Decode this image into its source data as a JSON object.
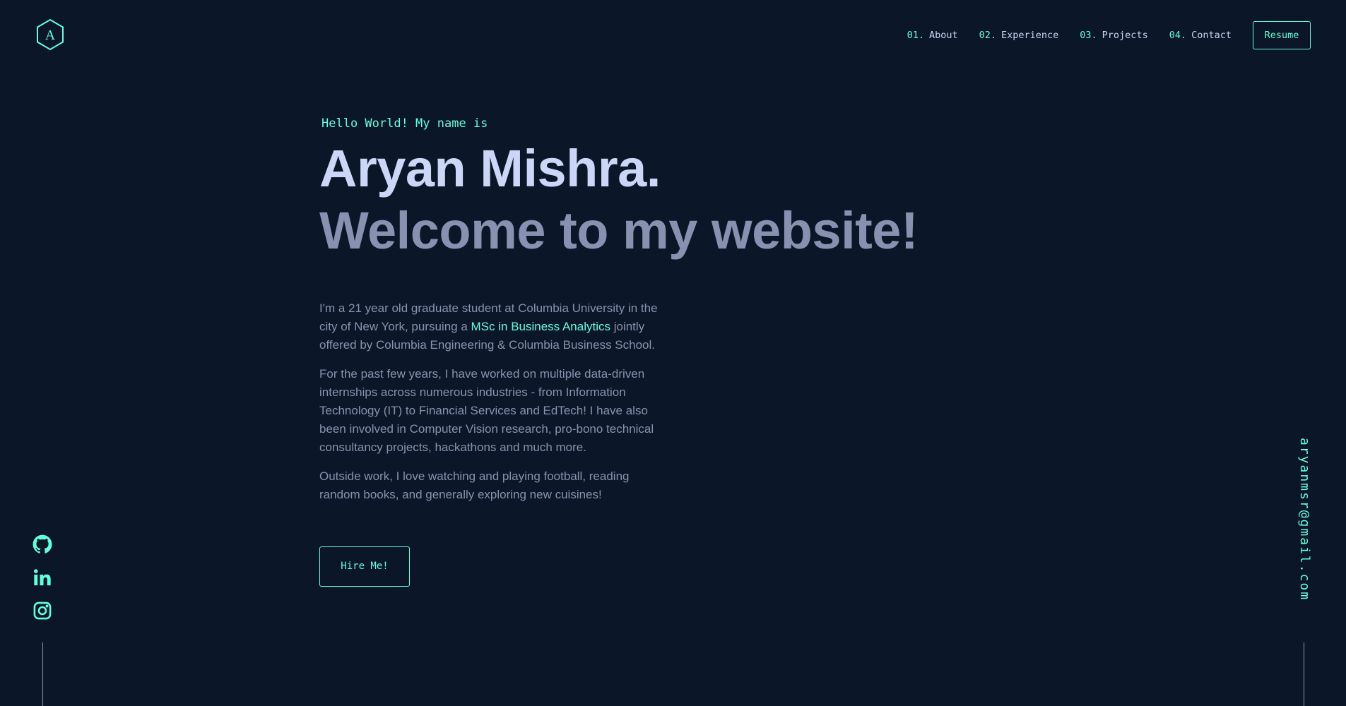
{
  "logo": {
    "letter": "A"
  },
  "nav": {
    "items": [
      {
        "num": "01.",
        "label": "About"
      },
      {
        "num": "02.",
        "label": "Experience"
      },
      {
        "num": "03.",
        "label": "Projects"
      },
      {
        "num": "04.",
        "label": "Contact"
      }
    ],
    "resume_label": "Resume"
  },
  "hero": {
    "greeting": "Hello World! My name is",
    "name": "Aryan Mishra.",
    "tagline": "Welcome to my website!",
    "bio1_before": "I'm a 21 year old graduate student at Columbia University in the city of New York, pursuing a ",
    "bio1_link": "MSc in Business Analytics",
    "bio1_after": " jointly offered by Columbia Engineering & Columbia Business School.",
    "bio2": "For the past few years, I have worked on multiple data-driven internships across numerous industries - from Information Technology (IT) to Financial Services and EdTech! I have also been involved in Computer Vision research, pro-bono technical consultancy projects, hackathons and much more.",
    "bio3": "Outside work, I love watching and playing football, reading random books, and generally exploring new cuisines!",
    "hire_label": "Hire Me!"
  },
  "socials": {
    "icons": [
      "github-icon",
      "linkedin-icon",
      "instagram-icon"
    ]
  },
  "email": "aryanmsr@gmail.com",
  "colors": {
    "background": "#0b1628",
    "accent": "#64ffda",
    "heading": "#ccd6f6",
    "body": "#8892b0"
  }
}
